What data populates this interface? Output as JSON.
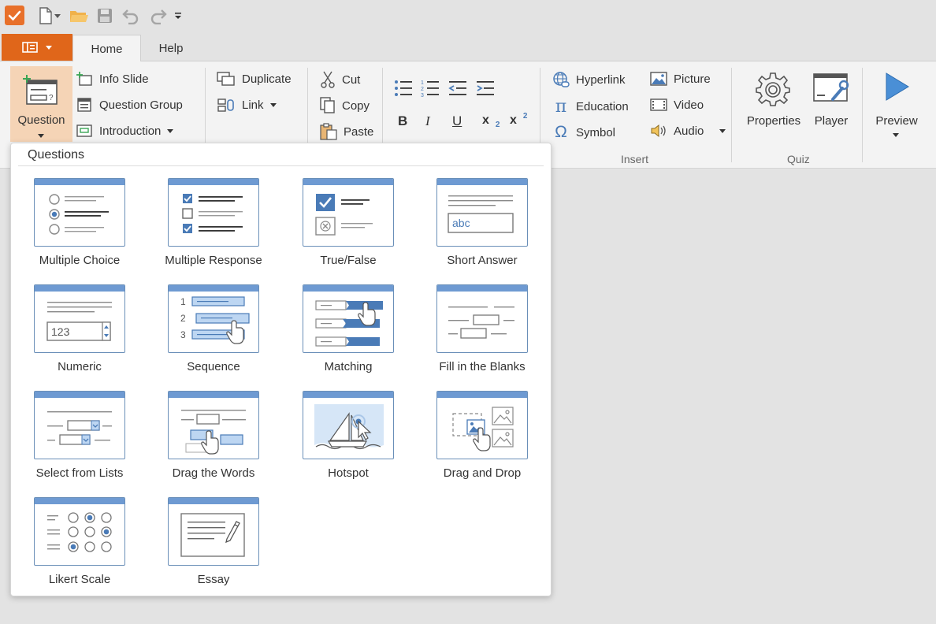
{
  "ribbon": {
    "tabs": {
      "home": "Home",
      "help": "Help"
    },
    "slides": {
      "question": "Question",
      "info_slide": "Info Slide",
      "question_group": "Question Group",
      "introduction": "Introduction"
    },
    "edit": {
      "duplicate": "Duplicate",
      "link": "Link"
    },
    "clipboard": {
      "cut": "Cut",
      "copy": "Copy",
      "paste": "Paste"
    },
    "insert": {
      "hyperlink": "Hyperlink",
      "education": "Education",
      "symbol": "Symbol",
      "picture": "Picture",
      "video": "Video",
      "audio": "Audio",
      "label": "Insert"
    },
    "quiz": {
      "properties": "Properties",
      "player": "Player",
      "label": "Quiz"
    },
    "preview": "Preview"
  },
  "panel": {
    "title": "Questions",
    "items": [
      {
        "label": "Multiple Choice",
        "icon": "multiple-choice-icon"
      },
      {
        "label": "Multiple Response",
        "icon": "multiple-response-icon"
      },
      {
        "label": "True/False",
        "icon": "true-false-icon"
      },
      {
        "label": "Short Answer",
        "icon": "short-answer-icon"
      },
      {
        "label": "Numeric",
        "icon": "numeric-icon"
      },
      {
        "label": "Sequence",
        "icon": "sequence-icon"
      },
      {
        "label": "Matching",
        "icon": "matching-icon"
      },
      {
        "label": "Fill in the Blanks",
        "icon": "fill-blanks-icon"
      },
      {
        "label": "Select from Lists",
        "icon": "select-lists-icon"
      },
      {
        "label": "Drag the Words",
        "icon": "drag-words-icon"
      },
      {
        "label": "Hotspot",
        "icon": "hotspot-icon"
      },
      {
        "label": "Drag and Drop",
        "icon": "drag-drop-icon"
      },
      {
        "label": "Likert Scale",
        "icon": "likert-icon"
      },
      {
        "label": "Essay",
        "icon": "essay-icon"
      }
    ],
    "thumb_text": {
      "short_answer": "abc",
      "numeric": "123",
      "seq1": "1",
      "seq2": "2",
      "seq3": "3"
    }
  },
  "colors": {
    "accent": "#e0661a",
    "icon_blue": "#4a7bb7",
    "thumb_header": "#6e9ad2"
  }
}
